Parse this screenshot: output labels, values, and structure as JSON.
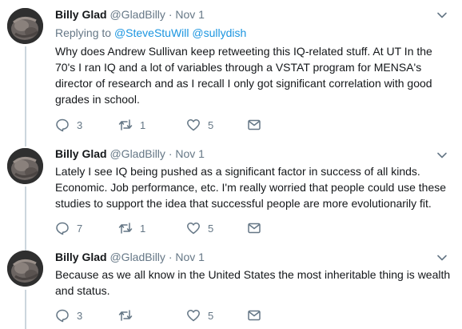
{
  "tweets": [
    {
      "name": "Billy Glad",
      "handle": "@GladBilly",
      "sep": "·",
      "date": "Nov 1",
      "reply_prefix": "Replying to",
      "reply_mention_1": "@SteveStuWill",
      "reply_mention_2": "@sullydish",
      "text": "Why does Andrew Sullivan keep retweeting this IQ-related stuff. At UT In the 70's I ran IQ and a lot of variables through a VSTAT program for MENSA's director of research and as I recall I only got significant correlation with good grades in school.",
      "replies": "3",
      "retweets": "1",
      "likes": "5"
    },
    {
      "name": "Billy Glad",
      "handle": "@GladBilly",
      "sep": "·",
      "date": "Nov 1",
      "text": "Lately I see IQ being pushed as a significant factor in success of all kinds. Economic. Job performance, etc. I'm really worried that people could use these studies to support the idea that successful people are more evolutionarily fit.",
      "replies": "7",
      "retweets": "1",
      "likes": "5"
    },
    {
      "name": "Billy Glad",
      "handle": "@GladBilly",
      "sep": "·",
      "date": "Nov 1",
      "text": "Because as we all know in the United States the most inheritable thing is wealth and status.",
      "replies": "3",
      "retweets": "",
      "likes": "5"
    }
  ],
  "colors": {
    "text": "#14171a",
    "muted": "#657786",
    "link": "#1b95e0",
    "thread_line": "#ccd6dd"
  },
  "icons": {
    "reply": "reply-icon",
    "retweet": "retweet-icon",
    "like": "heart-icon",
    "dm": "envelope-icon",
    "menu": "chevron-down-icon"
  }
}
